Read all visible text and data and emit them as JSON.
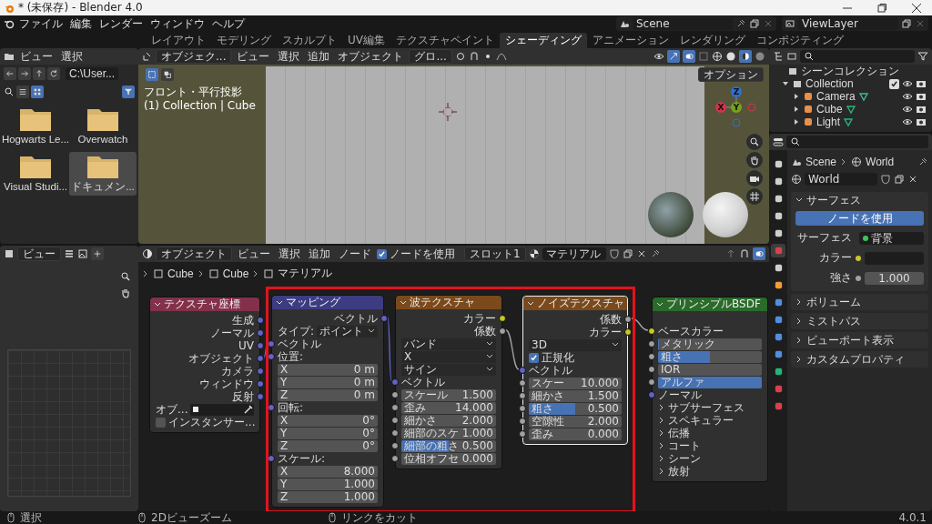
{
  "window": {
    "title": "* (未保存) - Blender 4.0"
  },
  "menu": [
    "ファイル",
    "編集",
    "レンダー",
    "ウィンドウ",
    "ヘルプ"
  ],
  "workspaces": [
    {
      "label": "レイアウト",
      "selected": false
    },
    {
      "label": "モデリング",
      "selected": false
    },
    {
      "label": "スカルプト",
      "selected": false
    },
    {
      "label": "UV編集",
      "selected": false
    },
    {
      "label": "テクスチャペイント",
      "selected": false
    },
    {
      "label": "シェーディング",
      "selected": true
    },
    {
      "label": "アニメーション",
      "selected": false
    },
    {
      "label": "レンダリング",
      "selected": false
    },
    {
      "label": "コンポジティング",
      "selected": false
    }
  ],
  "scene": {
    "name": "Scene"
  },
  "view_layer": {
    "name": "ViewLayer"
  },
  "file_browser": {
    "menu": [
      "ビュー",
      "選択"
    ],
    "path": "C:\\User...",
    "items": [
      {
        "name": "Hogwarts Le...",
        "selected": false
      },
      {
        "name": "Overwatch",
        "selected": false
      },
      {
        "name": "Visual Studi...",
        "selected": false
      },
      {
        "name": "ドキュメン...",
        "selected": true
      }
    ]
  },
  "viewport": {
    "mode": "オブジェク...",
    "menu": [
      "ビュー",
      "選択",
      "追加",
      "オブジェクト"
    ],
    "orientation": "グロ...",
    "view_name": "フロント・平行投影",
    "context": "(1) Collection | Cube",
    "options": "オプション",
    "axes": [
      {
        "label": "Z",
        "color": "#2f6fd0"
      },
      {
        "label": "X",
        "color": "#d0344a"
      },
      {
        "label": "Y",
        "color": "#76a11e"
      }
    ]
  },
  "image_editor": {
    "view": "ビュー"
  },
  "node_editor": {
    "mode": "オブジェクト",
    "menu": [
      "ビュー",
      "選択",
      "追加",
      "ノード"
    ],
    "use_nodes": {
      "label": "ノードを使用",
      "checked": true
    },
    "slot": "スロット1",
    "material": "マテリアル",
    "breadcrumbs": [
      "Cube",
      "Cube",
      "マテリアル"
    ],
    "nodes": [
      {
        "title": "テクスチャ座標",
        "color": "#83314a",
        "selected": false,
        "rows": [
          {
            "kind": "output",
            "label": "生成",
            "color": "#6363c7"
          },
          {
            "kind": "output",
            "label": "ノーマル",
            "color": "#6363c7"
          },
          {
            "kind": "output",
            "label": "UV",
            "color": "#6363c7"
          },
          {
            "kind": "output",
            "label": "オブジェクト",
            "color": "#6363c7"
          },
          {
            "kind": "output",
            "label": "カメラ",
            "color": "#6363c7"
          },
          {
            "kind": "output",
            "label": "ウィンドウ",
            "color": "#6363c7"
          },
          {
            "kind": "output",
            "label": "反射",
            "color": "#6363c7"
          },
          {
            "kind": "object",
            "label": "オブ..."
          },
          {
            "kind": "checkbox",
            "label": "インスタンサー...",
            "checked": false
          }
        ]
      },
      {
        "title": "マッピング",
        "color": "#3c3c83",
        "selected": false,
        "rows": [
          {
            "kind": "output",
            "label": "ベクトル",
            "color": "#6363c7"
          },
          {
            "kind": "select",
            "label": "タイプ:",
            "value": "ポイント"
          },
          {
            "kind": "input",
            "label": "ベクトル",
            "color": "#6363c7"
          },
          {
            "kind": "input",
            "label": "位置:",
            "color": "#6363c7"
          },
          {
            "kind": "field",
            "label": "X",
            "value": "0 m"
          },
          {
            "kind": "field",
            "label": "Y",
            "value": "0 m"
          },
          {
            "kind": "field",
            "label": "Z",
            "value": "0 m"
          },
          {
            "kind": "input",
            "label": "回転:",
            "color": "#6363c7"
          },
          {
            "kind": "field",
            "label": "X",
            "value": "0°"
          },
          {
            "kind": "field",
            "label": "Y",
            "value": "0°"
          },
          {
            "kind": "field",
            "label": "Z",
            "value": "0°"
          },
          {
            "kind": "input",
            "label": "スケール:",
            "color": "#6363c7"
          },
          {
            "kind": "field",
            "label": "X",
            "value": "8.000"
          },
          {
            "kind": "field",
            "label": "Y",
            "value": "1.000"
          },
          {
            "kind": "field",
            "label": "Z",
            "value": "1.000"
          }
        ]
      },
      {
        "title": "波テクスチャ",
        "color": "#7a4a1c",
        "selected": false,
        "rows": [
          {
            "kind": "output",
            "label": "カラー",
            "color": "#c7c729"
          },
          {
            "kind": "output",
            "label": "係数",
            "color": "#a1a1a1"
          },
          {
            "kind": "select",
            "value": "バンド"
          },
          {
            "kind": "select",
            "value": "X"
          },
          {
            "kind": "select",
            "value": "サイン"
          },
          {
            "kind": "input",
            "label": "ベクトル",
            "color": "#6363c7"
          },
          {
            "kind": "field",
            "label": "スケール",
            "value": "1.500",
            "color": "#a1a1a1"
          },
          {
            "kind": "field",
            "label": "歪み",
            "value": "14.000",
            "color": "#a1a1a1"
          },
          {
            "kind": "field",
            "label": "細かさ",
            "value": "2.000",
            "color": "#a1a1a1"
          },
          {
            "kind": "field",
            "label": "細部のスケ",
            "value": "1.000",
            "color": "#a1a1a1"
          },
          {
            "kind": "slider",
            "label": "細部の粗さ",
            "value": "0.500",
            "level": 0.5,
            "color": "#a1a1a1"
          },
          {
            "kind": "field",
            "label": "位相オフセ",
            "value": "0.000",
            "color": "#a1a1a1"
          }
        ]
      },
      {
        "title": "ノイズテクスチャ",
        "color": "#7a4a1c",
        "selected": true,
        "rows": [
          {
            "kind": "output",
            "label": "係数",
            "color": "#a1a1a1"
          },
          {
            "kind": "output",
            "label": "カラー",
            "color": "#c7c729"
          },
          {
            "kind": "select",
            "value": "3D"
          },
          {
            "kind": "checkbox",
            "label": "正規化",
            "checked": true
          },
          {
            "kind": "input",
            "label": "ベクトル",
            "color": "#6363c7"
          },
          {
            "kind": "field",
            "label": "スケー",
            "value": "10.000",
            "color": "#a1a1a1"
          },
          {
            "kind": "field",
            "label": "細かさ",
            "value": "1.500",
            "color": "#a1a1a1"
          },
          {
            "kind": "slider",
            "label": "粗さ",
            "value": "0.500",
            "level": 0.5,
            "color": "#a1a1a1"
          },
          {
            "kind": "field",
            "label": "空隙性",
            "value": "2.000",
            "color": "#a1a1a1"
          },
          {
            "kind": "field",
            "label": "歪み",
            "value": "0.000",
            "color": "#a1a1a1"
          }
        ]
      },
      {
        "title": "プリンシプルBSDF",
        "color": "#2a6a2a",
        "selected": false,
        "rows": [
          {
            "kind": "input",
            "label": "ベースカラー",
            "color": "#c7c729"
          },
          {
            "kind": "slider",
            "label": "メタリック",
            "level": 0,
            "color": "#a1a1a1"
          },
          {
            "kind": "slider",
            "label": "粗さ",
            "level": 0.5,
            "color": "#a1a1a1"
          },
          {
            "kind": "field",
            "label": "IOR",
            "color": "#a1a1a1"
          },
          {
            "kind": "slider",
            "label": "アルファ",
            "level": 1,
            "color": "#a1a1a1"
          },
          {
            "kind": "input",
            "label": "ノーマル",
            "color": "#6363c7"
          },
          {
            "kind": "panel",
            "label": "サブサーフェス"
          },
          {
            "kind": "panel",
            "label": "スペキュラー"
          },
          {
            "kind": "panel",
            "label": "伝播"
          },
          {
            "kind": "panel",
            "label": "コート"
          },
          {
            "kind": "panel",
            "label": "シーン"
          },
          {
            "kind": "panel",
            "label": "放射"
          }
        ]
      }
    ]
  },
  "outliner": {
    "title": "シーンコレクション",
    "collection": {
      "name": "Collection",
      "checked": true,
      "expanded": true,
      "children": [
        {
          "name": "Camera",
          "kind": "camera",
          "expanded": false
        },
        {
          "name": "Cube",
          "kind": "mesh",
          "expanded": false
        },
        {
          "name": "Light",
          "kind": "light",
          "expanded": false
        }
      ]
    }
  },
  "properties": {
    "tabs": [
      {
        "kind": "tool",
        "selected": false
      },
      {
        "kind": "render",
        "selected": false
      },
      {
        "kind": "output",
        "selected": false
      },
      {
        "kind": "view_layer",
        "selected": false
      },
      {
        "kind": "scene",
        "selected": false
      },
      {
        "kind": "world",
        "selected": true
      },
      {
        "kind": "collection",
        "selected": false
      },
      {
        "kind": "object",
        "selected": false
      },
      {
        "kind": "modifier",
        "selected": false
      },
      {
        "kind": "particles",
        "selected": false
      },
      {
        "kind": "physics",
        "selected": false
      },
      {
        "kind": "constraint",
        "selected": false
      },
      {
        "kind": "data",
        "selected": false
      },
      {
        "kind": "material",
        "selected": false
      },
      {
        "kind": "texture",
        "selected": false
      }
    ],
    "breadcrumbs": [
      "Scene",
      "World"
    ],
    "world": "World",
    "panels": [
      {
        "title": "サーフェス",
        "expanded": true
      },
      {
        "title": "ボリューム",
        "expanded": false
      },
      {
        "title": "ミストパス",
        "expanded": false
      },
      {
        "title": "ビューポート表示",
        "expanded": false
      },
      {
        "title": "カスタムプロパティ",
        "expanded": false
      }
    ],
    "surface": {
      "use_nodes": "ノードを使用",
      "surface_label": "サーフェス",
      "surface_value": "背景",
      "color_label": "カラー",
      "strength_label": "強さ",
      "strength": "1.000"
    }
  },
  "status_bar": {
    "items": [
      "選択",
      "2Dビューズーム",
      "リンクをカット"
    ],
    "version": "4.0.1"
  }
}
